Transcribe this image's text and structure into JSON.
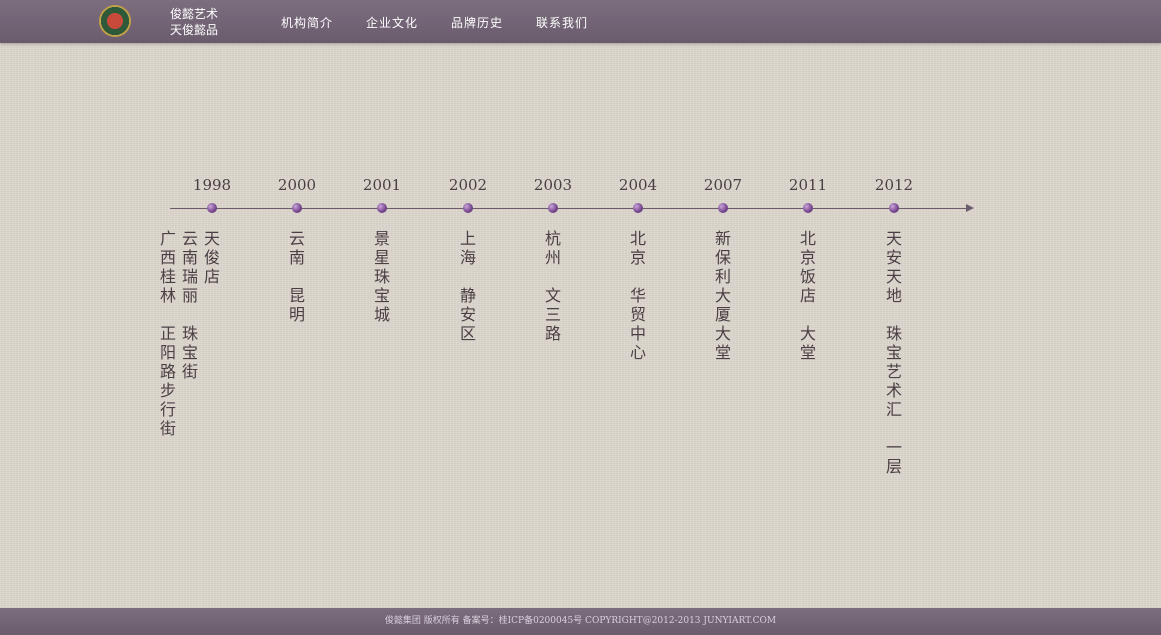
{
  "header": {
    "brand_line1": "俊懿艺术",
    "brand_line2": "天俊懿品",
    "logo_icon": "emblem-logo-icon",
    "nav": [
      "机构简介",
      "企业文化",
      "品牌历史",
      "联系我们"
    ]
  },
  "timeline": {
    "entries": [
      {
        "year": "1998",
        "columns": [
          "天俊店",
          "云南瑞丽 珠宝街",
          "广西桂林 正阳路步行街"
        ]
      },
      {
        "year": "2000",
        "columns": [
          "云南 昆明"
        ]
      },
      {
        "year": "2001",
        "columns": [
          "景星珠宝城"
        ]
      },
      {
        "year": "2002",
        "columns": [
          "上海 静安区"
        ]
      },
      {
        "year": "2003",
        "columns": [
          "杭州 文三路"
        ]
      },
      {
        "year": "2004",
        "columns": [
          "北京 华贸中心"
        ]
      },
      {
        "year": "2007",
        "columns": [
          "新保利大厦大堂"
        ]
      },
      {
        "year": "2011",
        "columns": [
          "北京饭店 大堂"
        ]
      },
      {
        "year": "2012",
        "columns": [
          "天安天地 珠宝艺术汇 一层"
        ]
      }
    ]
  },
  "footer": {
    "text": "俊懿集团 版权所有 备案号：桂ICP备0200045号 COPYRIGHT@2012-2013 JUNYIART.COM"
  }
}
